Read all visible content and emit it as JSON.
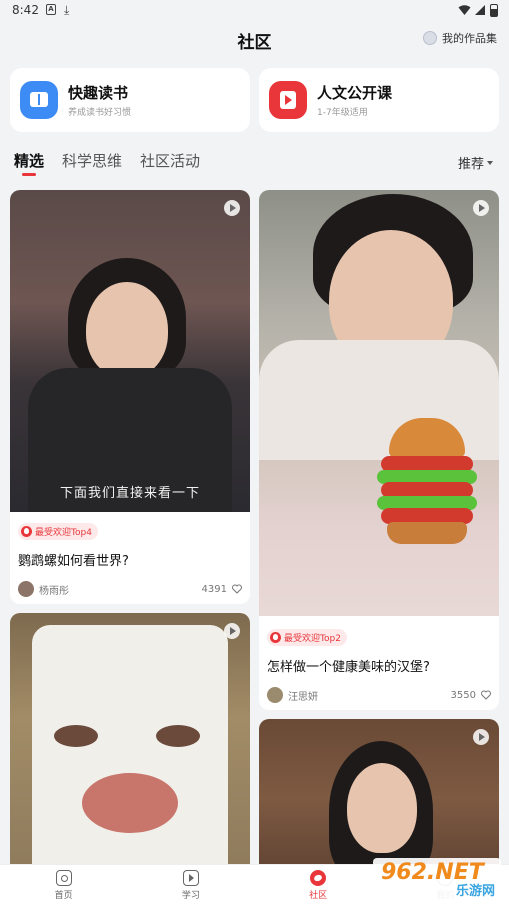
{
  "status_bar": {
    "time": "8:42",
    "a_icon": "A"
  },
  "header": {
    "title": "社区",
    "works_link": "我的作品集"
  },
  "features": [
    {
      "title": "快趣读书",
      "subtitle": "养成读书好习惯",
      "icon": "book-icon",
      "color": "#3d8cf5"
    },
    {
      "title": "人文公开课",
      "subtitle": "1-7年级适用",
      "icon": "play-icon",
      "color": "#e8363a"
    }
  ],
  "tabs": [
    "精选",
    "科学思维",
    "社区活动"
  ],
  "active_tab": "精选",
  "sort_label": "推荐",
  "cards": [
    {
      "subtitle_overlay": "下面我们直接来看一下",
      "badge": "最受欢迎Top4",
      "title": "鹦鹉螺如何看世界?",
      "author": "杨雨彤",
      "likes": "4391"
    },
    {
      "badge": "最受欢迎Top2",
      "title": "怎样做一个健康美味的汉堡?",
      "author": "汪思妍",
      "likes": "3550"
    },
    {},
    {}
  ],
  "bottom_nav": [
    "首页",
    "学习",
    "社区",
    "我的"
  ],
  "watermark": {
    "main": "962.NET",
    "sub": "乐游网"
  },
  "colors": {
    "accent": "#e8363a",
    "blue": "#3d8cf5",
    "background": "#f2f3f5"
  }
}
